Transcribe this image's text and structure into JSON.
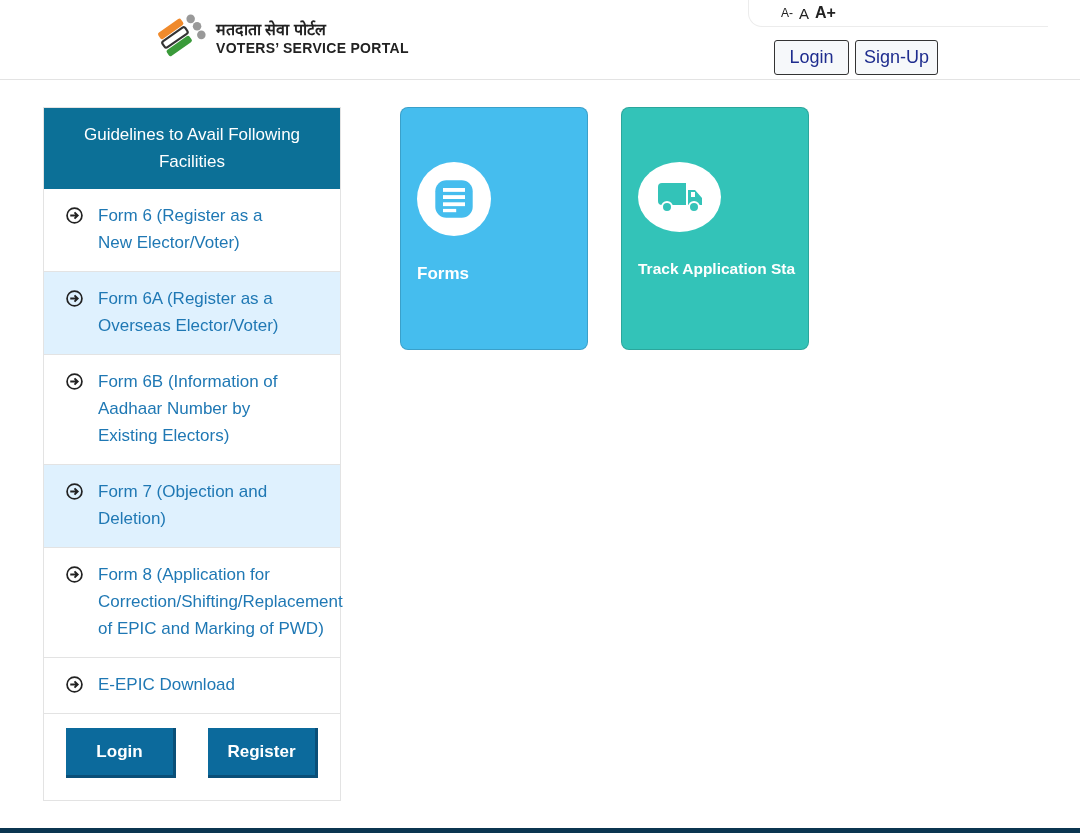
{
  "header": {
    "title_hindi": "मतदाता सेवा पोर्टल",
    "title": "VOTERS’ SERVICE PORTAL",
    "font_sizes": [
      "A-",
      "A",
      "A+"
    ],
    "buttons": [
      "Login",
      "Sign-Up"
    ]
  },
  "guidelines": {
    "title": "Guidelines to Avail Following Facilities",
    "items": [
      "Form 6 (Register as a New Elector/Voter)",
      "Form 6A (Register as a Overseas Elector/Voter)",
      "Form 6B (Information of Aadhaar Number by Existing Electors)",
      "Form 7 (Objection and Deletion)",
      "Form 8 (Application for Correction/Shifting/Replacement of EPIC and Marking of PWD)",
      "E-EPIC Download"
    ],
    "buttons": [
      "Login",
      "Register"
    ]
  },
  "cards": [
    {
      "kind": "forms",
      "label": "Forms",
      "color": "#45bdee"
    },
    {
      "kind": "truck",
      "label": "Track Application Sta",
      "color": "#33c3b8"
    }
  ]
}
